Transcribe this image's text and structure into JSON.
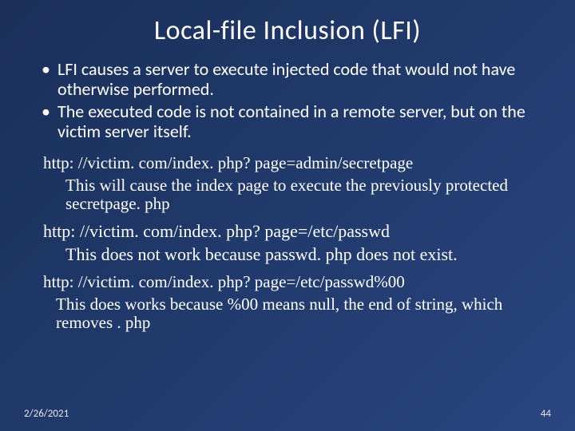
{
  "title": "Local-file Inclusion (LFI)",
  "bullets": [
    "LFI causes a server to execute injected code that would not have otherwise performed.",
    "The executed code is not contained in a remote server, but on the victim server itself."
  ],
  "examples": [
    {
      "url": "http: //victim. com/index. php? page=admin/secretpage",
      "explain": "This will cause the index page to execute the previously protected secretpage. php"
    },
    {
      "url": "http: //victim. com/index. php? page=/etc/passwd",
      "explain": "This does not work because passwd. php does not exist."
    },
    {
      "url": "http: //victim. com/index. php? page=/etc/passwd%00",
      "explain": "This does works because %00 means null, the end of string, which removes . php"
    }
  ],
  "footer": {
    "date": "2/26/2021",
    "page": "44"
  }
}
